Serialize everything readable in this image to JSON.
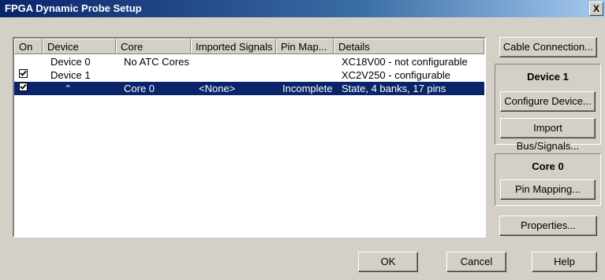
{
  "window": {
    "title": "FPGA Dynamic Probe Setup",
    "close_glyph": "X"
  },
  "table": {
    "columns": [
      "On",
      "Device",
      "Core",
      "Imported Signals",
      "Pin Map...",
      "Details"
    ],
    "rows": [
      {
        "on": "",
        "device": "Device 0",
        "core": "No ATC Cores",
        "signals": "",
        "pinmap": "",
        "details": "XC18V00 - not configurable",
        "checked": false,
        "selected": false
      },
      {
        "on": "",
        "device": "Device 1",
        "core": "",
        "signals": "",
        "pinmap": "",
        "details": "XC2V250 - configurable",
        "checked": true,
        "selected": false
      },
      {
        "on": "",
        "device": "\"",
        "core": "Core 0",
        "signals": "<None>",
        "pinmap": "Incomplete",
        "details": "State, 4 banks, 17 pins",
        "checked": true,
        "selected": true
      }
    ]
  },
  "buttons": {
    "cable_connection": "Cable Connection...",
    "configure_device": "Configure Device...",
    "import_bus": "Import Bus/Signals...",
    "pin_mapping": "Pin Mapping...",
    "properties": "Properties...",
    "ok": "OK",
    "cancel": "Cancel",
    "help": "Help"
  },
  "groups": {
    "device": "Device 1",
    "core": "Core 0"
  },
  "colors": {
    "selection": "#0a246a",
    "face": "#d4d0c8"
  }
}
